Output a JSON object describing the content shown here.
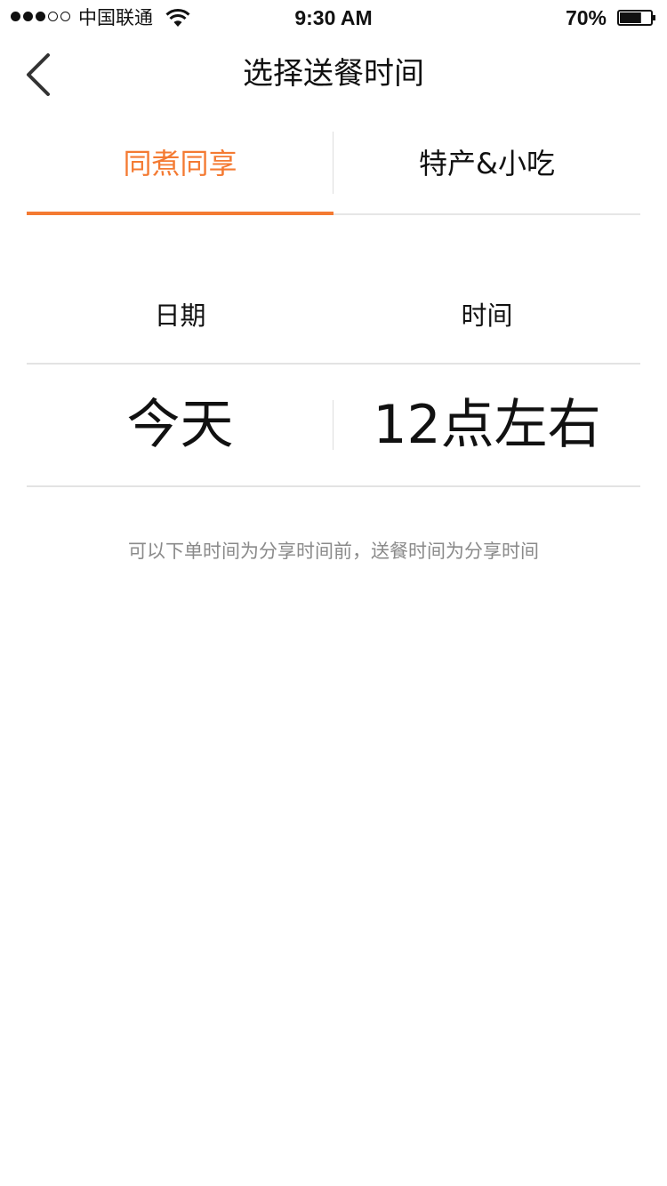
{
  "status_bar": {
    "carrier": "中国联通",
    "time": "9:30 AM",
    "battery": "70%",
    "battery_level": 0.7,
    "signal_filled": 3,
    "signal_total": 5
  },
  "nav": {
    "title": "选择送餐时间",
    "back_icon": "chevron-left-icon"
  },
  "tabs": [
    {
      "label": "同煮同享",
      "active": true
    },
    {
      "label": "特产&小吃",
      "active": false
    }
  ],
  "picker": {
    "date_header": "日期",
    "time_header": "时间",
    "date_value": "今天",
    "time_value": "12点左右"
  },
  "hint": "可以下单时间为分享时间前，送餐时间为分享时间",
  "colors": {
    "accent": "#f47a32",
    "divider": "#e3e3e3",
    "hint_text": "#8a8a8a"
  }
}
